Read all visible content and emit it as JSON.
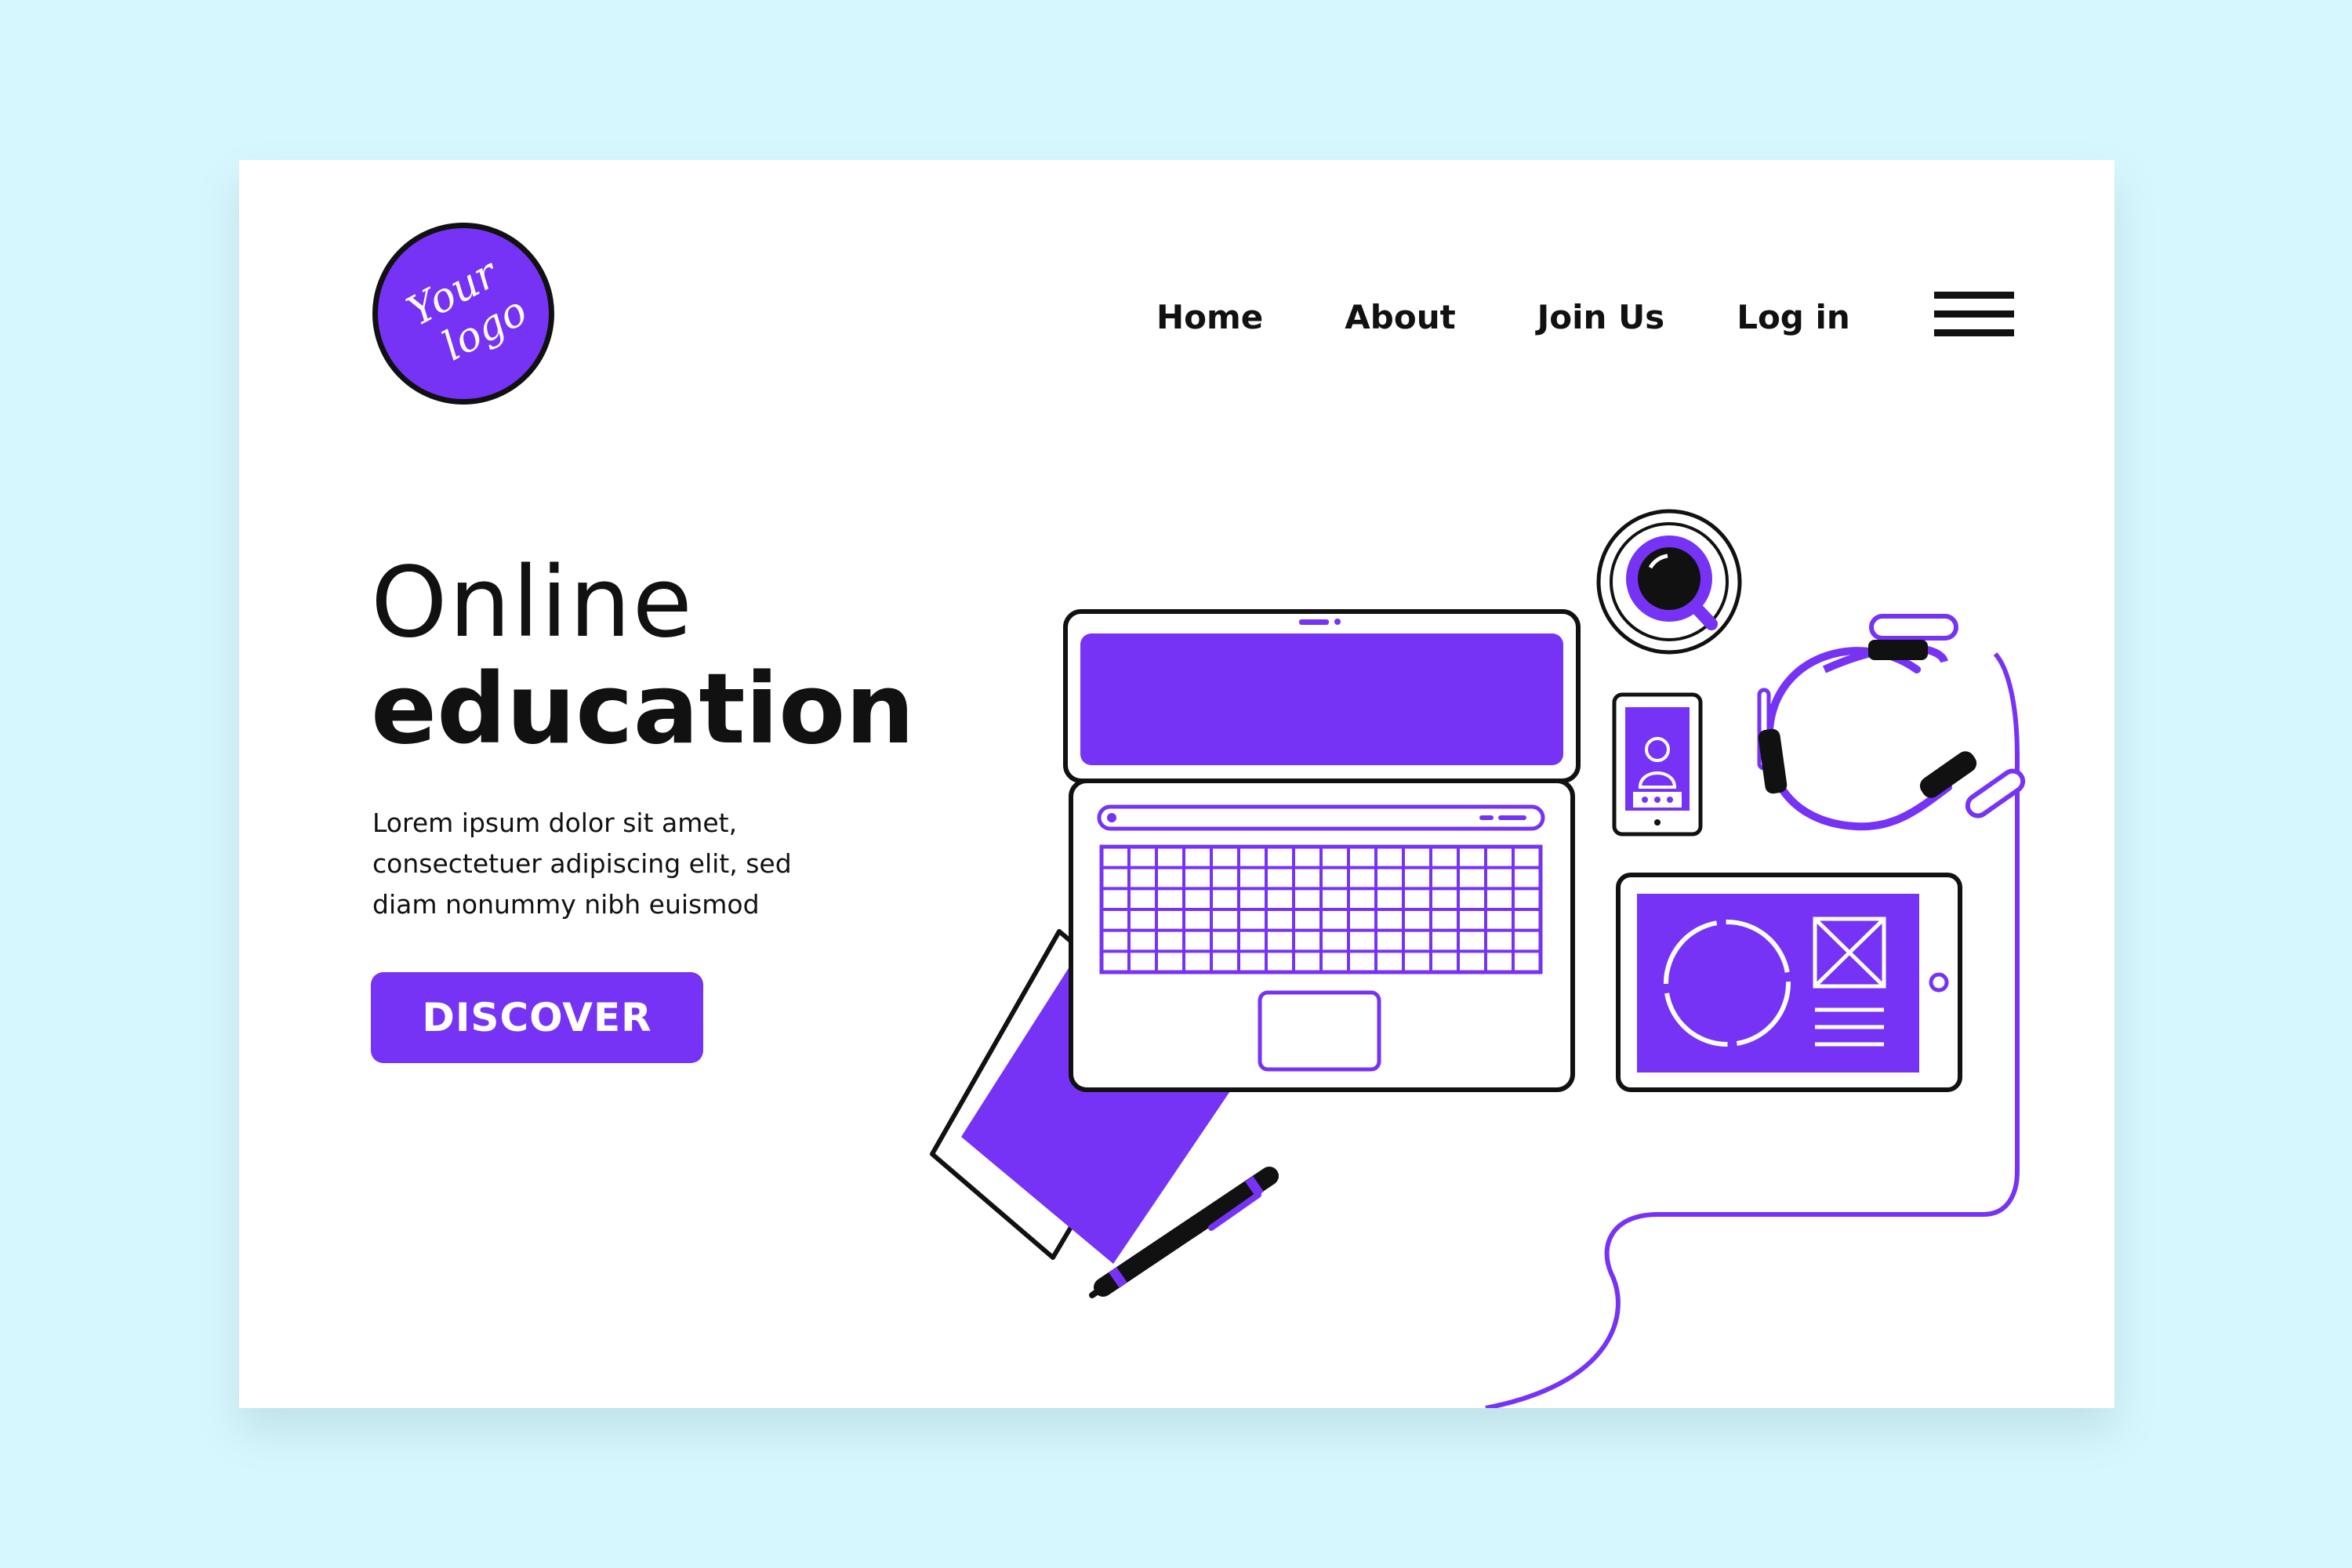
{
  "logo": {
    "line1": "Your",
    "line2": "logo"
  },
  "nav": {
    "items": [
      {
        "label": "Home"
      },
      {
        "label": "About"
      },
      {
        "label": "Join Us"
      },
      {
        "label": "Log in"
      }
    ],
    "menu_icon": "hamburger-menu-icon"
  },
  "hero": {
    "title_line1": "Online",
    "title_line2": "education",
    "description_lines": [
      "Lorem ipsum dolor sit amet,",
      "consectetuer adipiscing elit, sed",
      "diam nonummy nibh euismod"
    ],
    "cta_label": "DISCOVER"
  },
  "illustration": {
    "items": [
      "laptop-icon",
      "coffee-cup-icon",
      "smartphone-icon",
      "headphones-icon",
      "tablet-icon",
      "notebook-icon",
      "pen-icon"
    ]
  },
  "colors": {
    "accent": "#7733f5",
    "page_background": "#d6f7fd",
    "card_background": "#ffffff",
    "ink": "#111111"
  }
}
